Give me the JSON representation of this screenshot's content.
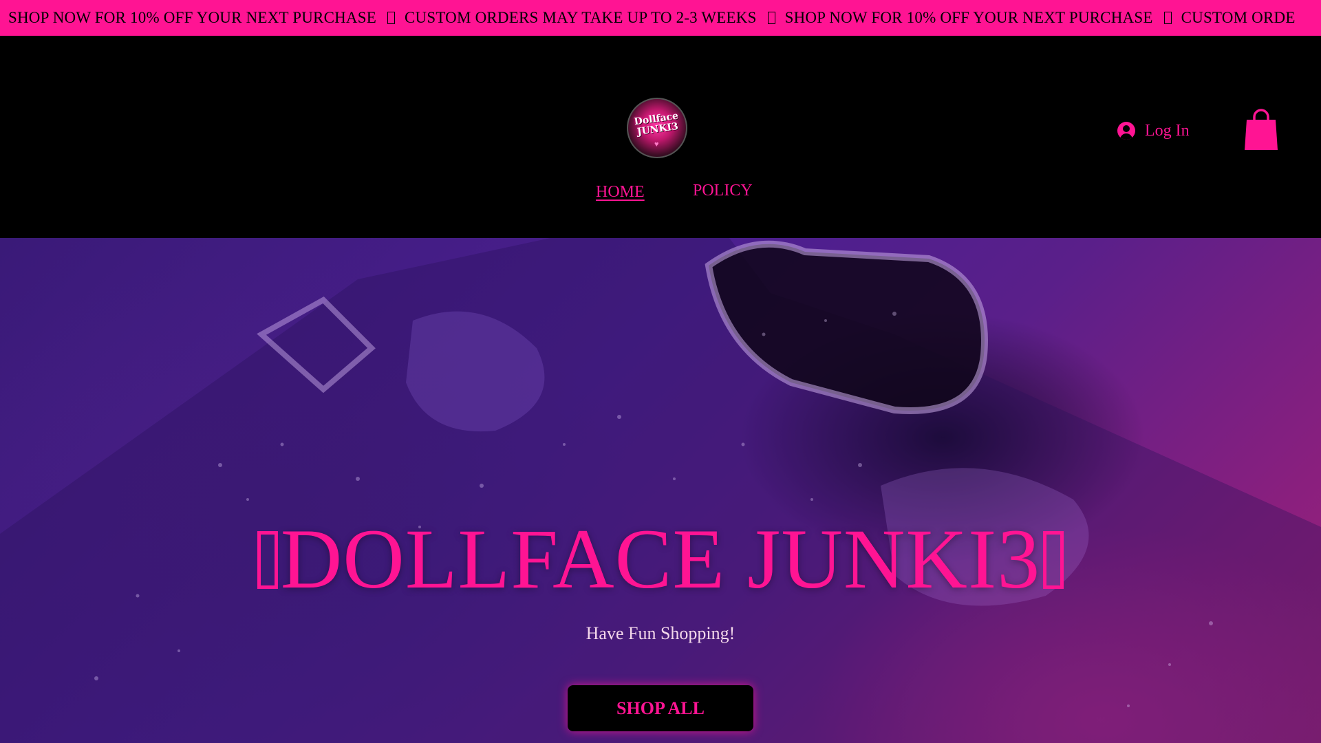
{
  "announcement": {
    "items": [
      "SHOP NOW FOR 10% OFF YOUR NEXT PURCHASE",
      "CUSTOM ORDERS MAY TAKE UP TO 2-3 WEEKS",
      "SHOP NOW FOR 10% OFF YOUR NEXT PURCHASE",
      "CUSTOM ORDE"
    ],
    "background_color": "#ff1493"
  },
  "header": {
    "logo_text": "Dollface JUNKI3",
    "login_label": "Log In",
    "login_icon": "user-avatar-icon",
    "cart_icon": "shopping-bag-icon",
    "nav": {
      "home": "HOME",
      "policy": "POLICY"
    }
  },
  "hero": {
    "title": "DOLLFACE JUNKI3",
    "subtitle": "Have Fun Shopping!",
    "cta_label": "SHOP ALL"
  },
  "colors": {
    "accent": "#ff1493",
    "header_bg": "#000000",
    "hero_purple": "#4b1f8f"
  }
}
